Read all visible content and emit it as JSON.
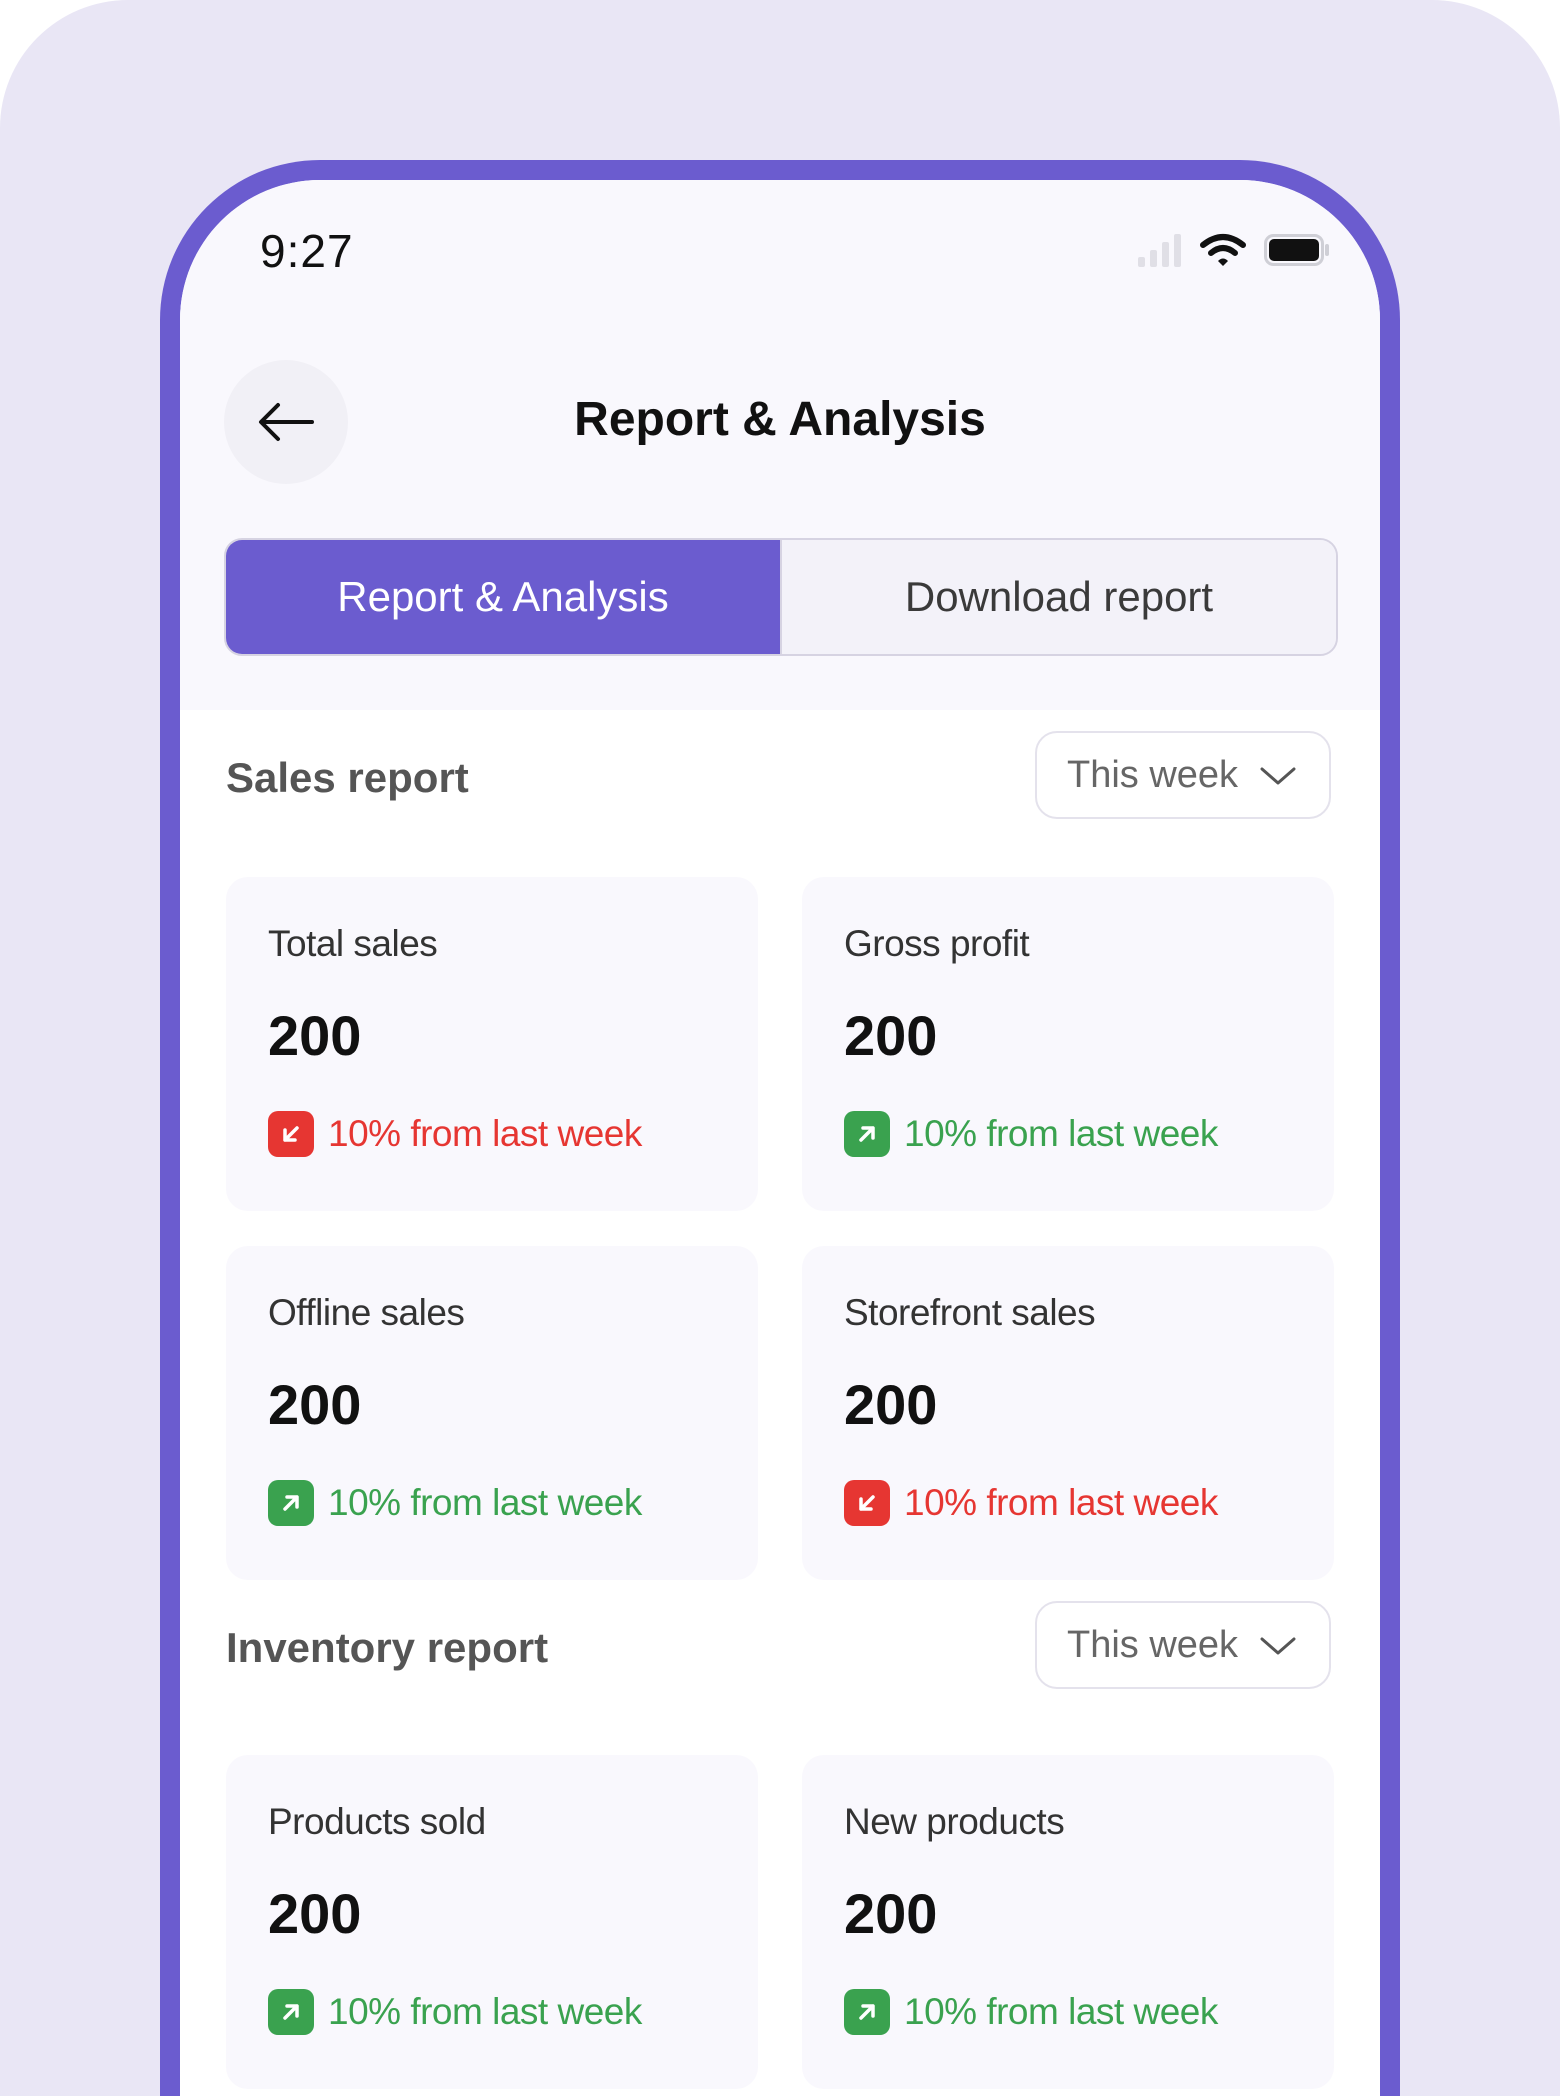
{
  "status": {
    "time": "9:27",
    "icons": [
      "signal-icon",
      "wifi-icon",
      "battery-icon"
    ]
  },
  "header": {
    "title": "Report & Analysis",
    "back_icon": "arrow-left-icon"
  },
  "tabs": [
    {
      "label": "Report & Analysis",
      "active": true
    },
    {
      "label": "Download report",
      "active": false
    }
  ],
  "sales_report": {
    "title": "Sales report",
    "period": "This week",
    "cards": [
      {
        "label": "Total sales",
        "value": "200",
        "change": "10% from last week",
        "trend": "down"
      },
      {
        "label": "Gross profit",
        "value": "200",
        "change": "10% from last week",
        "trend": "up"
      },
      {
        "label": "Offline sales",
        "value": "200",
        "change": "10% from last week",
        "trend": "up"
      },
      {
        "label": "Storefront sales",
        "value": "200",
        "change": "10% from last week",
        "trend": "down"
      }
    ]
  },
  "inventory_report": {
    "title": "Inventory report",
    "period": "This week",
    "cards": [
      {
        "label": "Products sold",
        "value": "200",
        "change": "10% from last week",
        "trend": "up"
      },
      {
        "label": "New products",
        "value": "200",
        "change": "10% from last week",
        "trend": "up"
      }
    ]
  },
  "colors": {
    "accent": "#6b5ccf",
    "up": "#3aa24f",
    "down": "#e63632",
    "background": "#e9e6f5"
  }
}
